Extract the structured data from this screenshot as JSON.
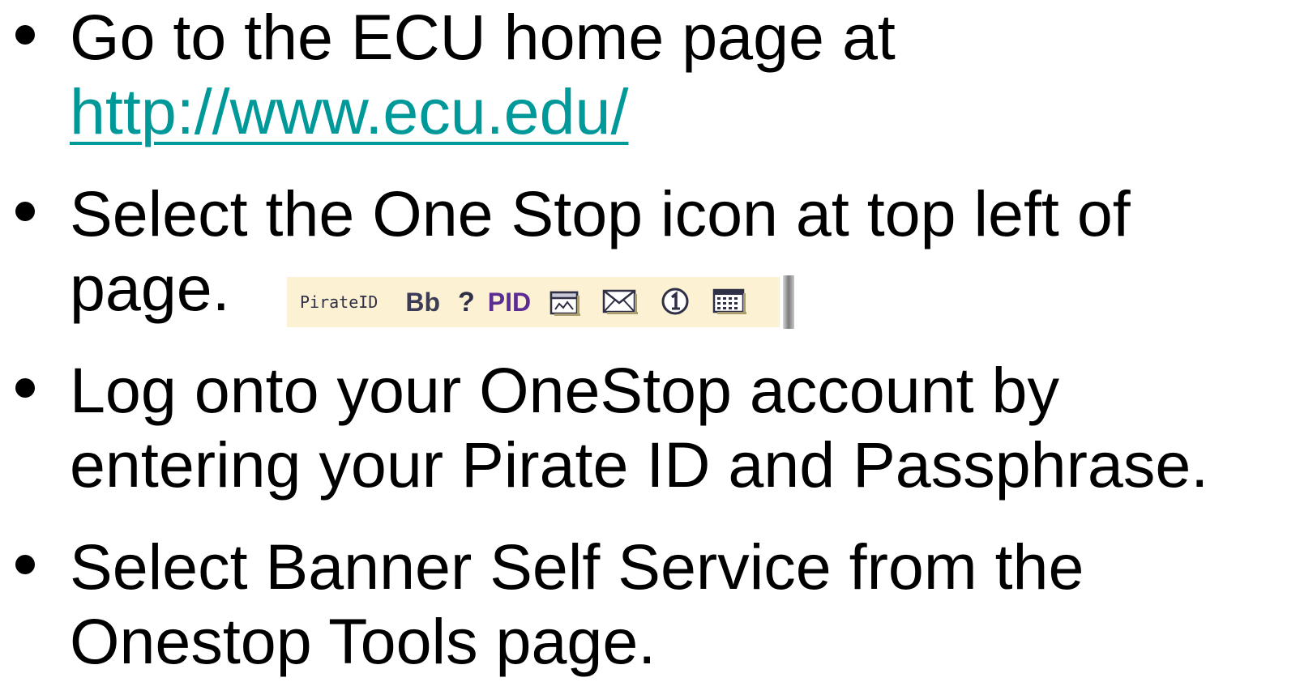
{
  "bullets": [
    {
      "line1": "Go to the ECU home page at",
      "link": "http://www.ecu.edu/"
    },
    {
      "line1": "Select the One Stop icon at top left of",
      "line2": "page."
    },
    {
      "line1": "Log onto your OneStop account by",
      "line2": "entering your Pirate ID and Passphrase."
    },
    {
      "line1": "Select Banner Self Service from the",
      "line2": "Onestop Tools page."
    }
  ],
  "toolbar": {
    "pirateid_label": "PirateID",
    "bb_label": "Bb",
    "help_label": "?",
    "pid_label": "PID",
    "icons": [
      "folder-icon",
      "mail-icon",
      "onestop-icon",
      "calendar-icon"
    ],
    "colors": {
      "background": "#fcf2d3",
      "text": "#2f2f46",
      "pid": "#5b2c91",
      "link": "#009999"
    }
  }
}
